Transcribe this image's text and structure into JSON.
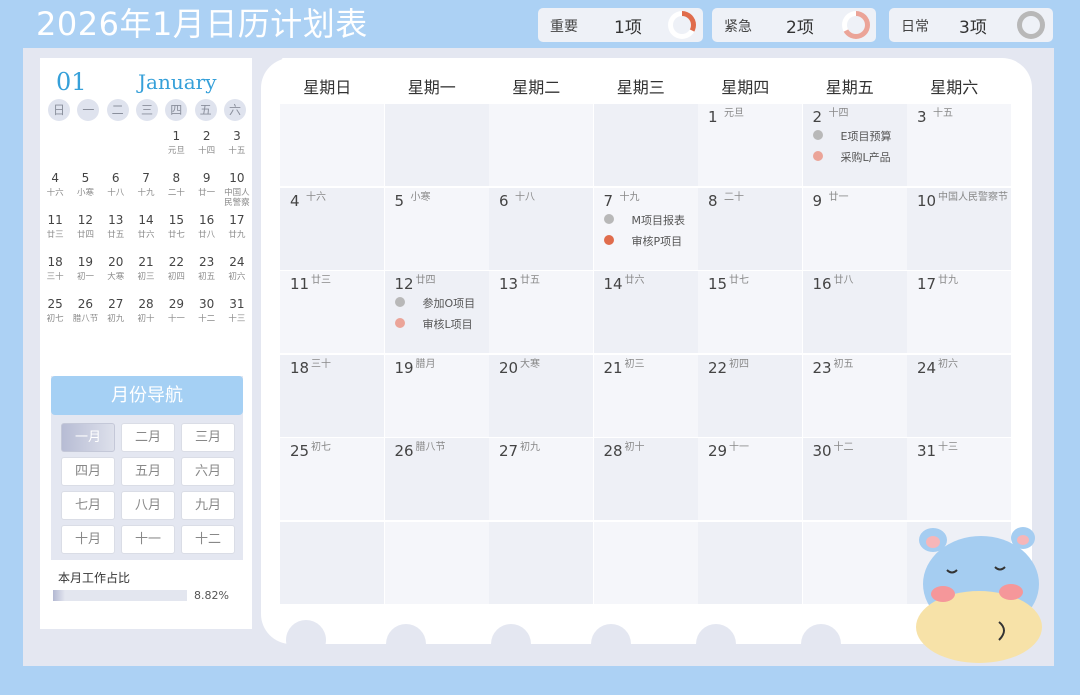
{
  "title": "2026年1月日历计划表",
  "stats": [
    {
      "label": "重要",
      "count": "1项",
      "percent": 33,
      "color": "#e06c4c"
    },
    {
      "label": "紧急",
      "count": "2项",
      "percent": 67,
      "color": "#eba498"
    },
    {
      "label": "日常",
      "count": "3项",
      "percent": 100,
      "color": "#b8b8b8"
    }
  ],
  "mini": {
    "month_num": "01",
    "month_name": "January",
    "weekdays": [
      "日",
      "一",
      "二",
      "三",
      "四",
      "五",
      "六"
    ],
    "cells": [
      {
        "d": "",
        "l": ""
      },
      {
        "d": "",
        "l": ""
      },
      {
        "d": "",
        "l": ""
      },
      {
        "d": "",
        "l": ""
      },
      {
        "d": "1",
        "l": "元旦"
      },
      {
        "d": "2",
        "l": "十四"
      },
      {
        "d": "3",
        "l": "十五"
      },
      {
        "d": "4",
        "l": "十六"
      },
      {
        "d": "5",
        "l": "小寒"
      },
      {
        "d": "6",
        "l": "十八"
      },
      {
        "d": "7",
        "l": "十九"
      },
      {
        "d": "8",
        "l": "二十"
      },
      {
        "d": "9",
        "l": "廿一"
      },
      {
        "d": "10",
        "l": "中国人民警察节"
      },
      {
        "d": "11",
        "l": "廿三"
      },
      {
        "d": "12",
        "l": "廿四"
      },
      {
        "d": "13",
        "l": "廿五"
      },
      {
        "d": "14",
        "l": "廿六"
      },
      {
        "d": "15",
        "l": "廿七"
      },
      {
        "d": "16",
        "l": "廿八"
      },
      {
        "d": "17",
        "l": "廿九"
      },
      {
        "d": "18",
        "l": "三十"
      },
      {
        "d": "19",
        "l": "初一"
      },
      {
        "d": "20",
        "l": "大寒"
      },
      {
        "d": "21",
        "l": "初三"
      },
      {
        "d": "22",
        "l": "初四"
      },
      {
        "d": "23",
        "l": "初五"
      },
      {
        "d": "24",
        "l": "初六"
      },
      {
        "d": "25",
        "l": "初七"
      },
      {
        "d": "26",
        "l": "腊八节"
      },
      {
        "d": "27",
        "l": "初九"
      },
      {
        "d": "28",
        "l": "初十"
      },
      {
        "d": "29",
        "l": "十一"
      },
      {
        "d": "30",
        "l": "十二"
      },
      {
        "d": "31",
        "l": "十三"
      },
      {
        "d": "",
        "l": ""
      },
      {
        "d": "",
        "l": ""
      },
      {
        "d": "",
        "l": ""
      },
      {
        "d": "",
        "l": ""
      },
      {
        "d": "",
        "l": ""
      },
      {
        "d": "",
        "l": ""
      },
      {
        "d": "",
        "l": ""
      }
    ]
  },
  "nav": {
    "title": "月份导航",
    "months": [
      "一月",
      "二月",
      "三月",
      "四月",
      "五月",
      "六月",
      "七月",
      "八月",
      "九月",
      "十月",
      "十一",
      "十二"
    ],
    "selected": 0
  },
  "ratio": {
    "label": "本月工作占比",
    "value": "8.82%",
    "fraction": 0.0882
  },
  "calendar": {
    "headers": [
      "星期日",
      "星期一",
      "星期二",
      "星期三",
      "星期四",
      "星期五",
      "星期六"
    ],
    "days": [
      {
        "d": "",
        "l": ""
      },
      {
        "d": "",
        "l": ""
      },
      {
        "d": "",
        "l": ""
      },
      {
        "d": "",
        "l": ""
      },
      {
        "d": "1",
        "l": "元旦"
      },
      {
        "d": "2",
        "l": "十四",
        "ev": [
          {
            "t": "E项目预算",
            "c": "#b8b8b8"
          },
          {
            "t": "采购L产品",
            "c": "#eba498"
          }
        ]
      },
      {
        "d": "3",
        "l": "十五"
      },
      {
        "d": "4",
        "l": "十六"
      },
      {
        "d": "5",
        "l": "小寒"
      },
      {
        "d": "6",
        "l": "十八"
      },
      {
        "d": "7",
        "l": "十九",
        "ev": [
          {
            "t": "M项目报表",
            "c": "#b8b8b8"
          },
          {
            "t": "审核P项目",
            "c": "#e06c4c"
          }
        ]
      },
      {
        "d": "8",
        "l": "二十"
      },
      {
        "d": "9",
        "l": "廿一"
      },
      {
        "d": "10",
        "l": "中国人民警察节"
      },
      {
        "d": "11",
        "l": "廿三"
      },
      {
        "d": "12",
        "l": "廿四",
        "ev": [
          {
            "t": "参加O项目",
            "c": "#b8b8b8"
          },
          {
            "t": "审核L项目",
            "c": "#eba498"
          }
        ]
      },
      {
        "d": "13",
        "l": "廿五"
      },
      {
        "d": "14",
        "l": "廿六"
      },
      {
        "d": "15",
        "l": "廿七"
      },
      {
        "d": "16",
        "l": "廿八"
      },
      {
        "d": "17",
        "l": "廿九"
      },
      {
        "d": "18",
        "l": "三十"
      },
      {
        "d": "19",
        "l": "腊月"
      },
      {
        "d": "20",
        "l": "大寒"
      },
      {
        "d": "21",
        "l": "初三"
      },
      {
        "d": "22",
        "l": "初四"
      },
      {
        "d": "23",
        "l": "初五"
      },
      {
        "d": "24",
        "l": "初六"
      },
      {
        "d": "25",
        "l": "初七"
      },
      {
        "d": "26",
        "l": "腊八节"
      },
      {
        "d": "27",
        "l": "初九"
      },
      {
        "d": "28",
        "l": "初十"
      },
      {
        "d": "29",
        "l": "十一"
      },
      {
        "d": "30",
        "l": "十二"
      },
      {
        "d": "31",
        "l": "十三"
      },
      {
        "d": "",
        "l": ""
      },
      {
        "d": "",
        "l": ""
      },
      {
        "d": "",
        "l": ""
      },
      {
        "d": "",
        "l": ""
      },
      {
        "d": "",
        "l": ""
      },
      {
        "d": "",
        "l": ""
      },
      {
        "d": "",
        "l": ""
      }
    ]
  }
}
